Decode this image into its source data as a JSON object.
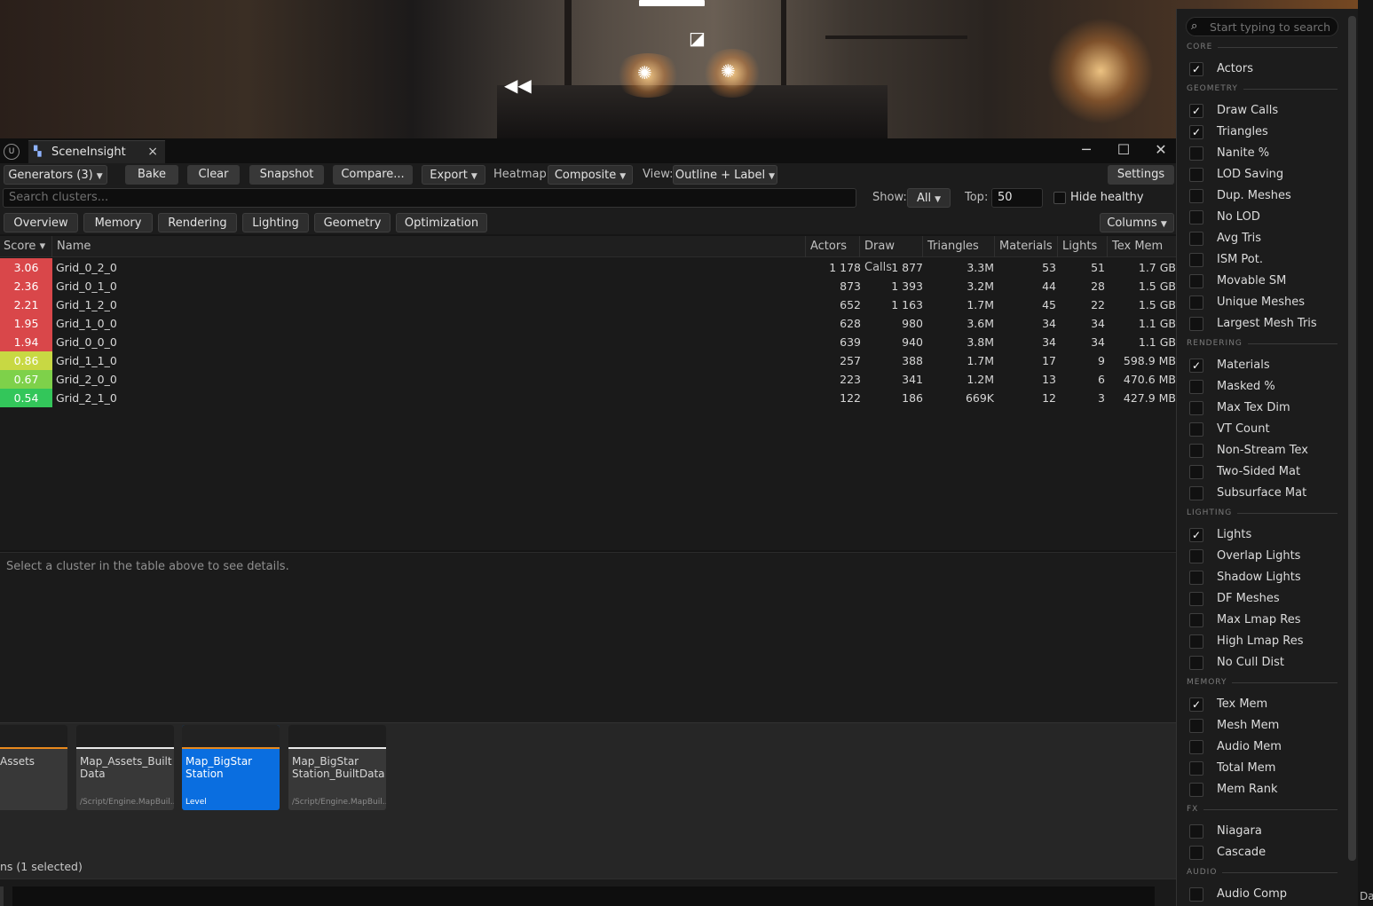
{
  "window": {
    "tab_title": "SceneInsight",
    "tab_close": "×",
    "minimize": "─",
    "maximize": "☐",
    "close": "✕"
  },
  "toolbar": {
    "generators": "Generators (3)",
    "bake": "Bake",
    "clear": "Clear",
    "snapshot": "Snapshot",
    "compare": "Compare...",
    "export": "Export",
    "heatmap_label": "Heatmap:",
    "heatmap_value": "Composite",
    "view_label": "View:",
    "view_value": "Outline + Label",
    "settings": "Settings"
  },
  "filter": {
    "search_placeholder": "Search clusters...",
    "show_label": "Show:",
    "show_value": "All",
    "top_label": "Top:",
    "top_value": "50",
    "hide_healthy": "Hide healthy clusters",
    "hide_healthy_checked": false
  },
  "tabs": [
    "Overview",
    "Memory",
    "Rendering",
    "Lighting",
    "Geometry",
    "Optimization"
  ],
  "columns_button": "Columns",
  "table": {
    "headers": [
      "Score",
      "Name",
      "Actors",
      "Draw Calls",
      "Triangles",
      "Materials",
      "Lights",
      "Tex Mem"
    ],
    "sort_indicator": "▾",
    "rows": [
      {
        "score": "3.06",
        "color": "#d9474a",
        "name": "Grid_0_2_0",
        "actors": "1 178",
        "draw_calls": "1 877",
        "triangles": "3.3M",
        "materials": "53",
        "lights": "51",
        "tex_mem": "1.7 GB"
      },
      {
        "score": "2.36",
        "color": "#d9474a",
        "name": "Grid_0_1_0",
        "actors": "873",
        "draw_calls": "1 393",
        "triangles": "3.2M",
        "materials": "44",
        "lights": "28",
        "tex_mem": "1.5 GB"
      },
      {
        "score": "2.21",
        "color": "#d9474a",
        "name": "Grid_1_2_0",
        "actors": "652",
        "draw_calls": "1 163",
        "triangles": "1.7M",
        "materials": "45",
        "lights": "22",
        "tex_mem": "1.5 GB"
      },
      {
        "score": "1.95",
        "color": "#d9474a",
        "name": "Grid_1_0_0",
        "actors": "628",
        "draw_calls": "980",
        "triangles": "3.6M",
        "materials": "34",
        "lights": "34",
        "tex_mem": "1.1 GB"
      },
      {
        "score": "1.94",
        "color": "#d9474a",
        "name": "Grid_0_0_0",
        "actors": "639",
        "draw_calls": "940",
        "triangles": "3.8M",
        "materials": "34",
        "lights": "34",
        "tex_mem": "1.1 GB"
      },
      {
        "score": "0.86",
        "color": "#c8d843",
        "name": "Grid_1_1_0",
        "actors": "257",
        "draw_calls": "388",
        "triangles": "1.7M",
        "materials": "17",
        "lights": "9",
        "tex_mem": "598.9 MB"
      },
      {
        "score": "0.67",
        "color": "#7ed14a",
        "name": "Grid_2_0_0",
        "actors": "223",
        "draw_calls": "341",
        "triangles": "1.2M",
        "materials": "13",
        "lights": "6",
        "tex_mem": "470.6 MB"
      },
      {
        "score": "0.54",
        "color": "#33c65a",
        "name": "Grid_2_1_0",
        "actors": "122",
        "draw_calls": "186",
        "triangles": "669K",
        "materials": "12",
        "lights": "3",
        "tex_mem": "427.9 MB"
      }
    ]
  },
  "details": {
    "hint": "Select a cluster in the table above to see details."
  },
  "assets": [
    {
      "name": "Assets",
      "path": "",
      "bar": "#e8891d",
      "selected": false
    },
    {
      "name": "Map_Assets_Built Data",
      "path": "/Script/Engine.MapBuil...",
      "bar": "#e8e8e8",
      "selected": false
    },
    {
      "name": "Map_BigStar Station",
      "path": "Level",
      "bar": "#e8891d",
      "selected": true
    },
    {
      "name": "Map_BigStar Station_BuiltData",
      "path": "/Script/Engine.MapBuil...",
      "bar": "#e8e8e8",
      "selected": false
    }
  ],
  "status": {
    "items_selected": "ns (1 selected)",
    "far_right": "Da"
  },
  "column_panel": {
    "search_placeholder": "Start typing to search",
    "sections": [
      {
        "title": "CORE",
        "items": [
          {
            "label": "Actors",
            "checked": true
          }
        ]
      },
      {
        "title": "GEOMETRY",
        "items": [
          {
            "label": "Draw Calls",
            "checked": true
          },
          {
            "label": "Triangles",
            "checked": true
          },
          {
            "label": "Nanite %",
            "checked": false
          },
          {
            "label": "LOD Saving",
            "checked": false
          },
          {
            "label": "Dup. Meshes",
            "checked": false
          },
          {
            "label": "No LOD",
            "checked": false
          },
          {
            "label": "Avg Tris",
            "checked": false
          },
          {
            "label": "ISM Pot.",
            "checked": false
          },
          {
            "label": "Movable SM",
            "checked": false
          },
          {
            "label": "Unique Meshes",
            "checked": false
          },
          {
            "label": "Largest Mesh Tris",
            "checked": false
          }
        ]
      },
      {
        "title": "RENDERING",
        "items": [
          {
            "label": "Materials",
            "checked": true
          },
          {
            "label": "Masked %",
            "checked": false
          },
          {
            "label": "Max Tex Dim",
            "checked": false
          },
          {
            "label": "VT Count",
            "checked": false
          },
          {
            "label": "Non-Stream Tex",
            "checked": false
          },
          {
            "label": "Two-Sided Mat",
            "checked": false
          },
          {
            "label": "Subsurface Mat",
            "checked": false
          }
        ]
      },
      {
        "title": "LIGHTING",
        "items": [
          {
            "label": "Lights",
            "checked": true
          },
          {
            "label": "Overlap Lights",
            "checked": false
          },
          {
            "label": "Shadow Lights",
            "checked": false
          },
          {
            "label": "DF Meshes",
            "checked": false
          },
          {
            "label": "Max Lmap Res",
            "checked": false
          },
          {
            "label": "High Lmap Res",
            "checked": false
          },
          {
            "label": "No Cull Dist",
            "checked": false
          }
        ]
      },
      {
        "title": "MEMORY",
        "items": [
          {
            "label": "Tex Mem",
            "checked": true
          },
          {
            "label": "Mesh Mem",
            "checked": false
          },
          {
            "label": "Audio Mem",
            "checked": false
          },
          {
            "label": "Total Mem",
            "checked": false
          },
          {
            "label": "Mem Rank",
            "checked": false
          }
        ]
      },
      {
        "title": "FX",
        "items": [
          {
            "label": "Niagara",
            "checked": false
          },
          {
            "label": "Cascade",
            "checked": false
          }
        ]
      },
      {
        "title": "AUDIO",
        "items": [
          {
            "label": "Audio Comp",
            "checked": false
          }
        ]
      }
    ]
  }
}
